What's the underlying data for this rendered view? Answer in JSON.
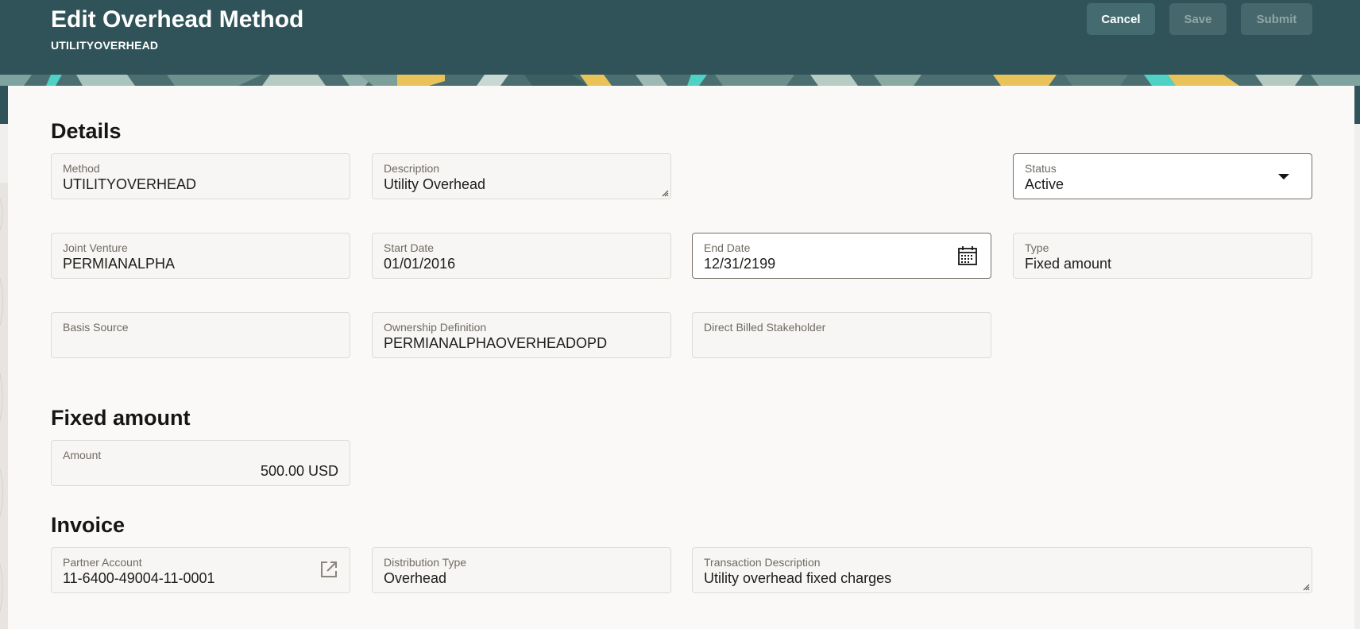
{
  "header": {
    "title": "Edit Overhead Method",
    "subtitle": "UTILITYOVERHEAD",
    "cancel_label": "Cancel",
    "save_label": "Save",
    "submit_label": "Submit"
  },
  "sections": {
    "details": "Details",
    "fixed_amount": "Fixed amount",
    "invoice": "Invoice"
  },
  "fields": {
    "method": {
      "label": "Method",
      "value": "UTILITYOVERHEAD"
    },
    "description": {
      "label": "Description",
      "value": "Utility Overhead"
    },
    "status": {
      "label": "Status",
      "value": "Active"
    },
    "joint_venture": {
      "label": "Joint Venture",
      "value": "PERMIANALPHA"
    },
    "start_date": {
      "label": "Start Date",
      "value": "01/01/2016"
    },
    "end_date": {
      "label": "End Date",
      "value": "12/31/2199"
    },
    "type": {
      "label": "Type",
      "value": "Fixed amount"
    },
    "basis_source": {
      "label": "Basis Source",
      "value": ""
    },
    "ownership_definition": {
      "label": "Ownership Definition",
      "value": "PERMIANALPHAOVERHEADOPD"
    },
    "direct_billed_stakeholder": {
      "label": "Direct Billed Stakeholder",
      "value": ""
    },
    "amount": {
      "label": "Amount",
      "value": "500.00 USD"
    },
    "partner_account": {
      "label": "Partner Account",
      "value": "11-6400-49004-11-0001"
    },
    "distribution_type": {
      "label": "Distribution Type",
      "value": "Overhead"
    },
    "transaction_description": {
      "label": "Transaction Description",
      "value": "Utility overhead fixed charges"
    }
  },
  "icons": {
    "status_dropdown": "chevron-down-icon",
    "end_date_picker": "calendar-icon",
    "partner_account_link": "external-link-icon",
    "textarea_resize": "resize-handle-icon"
  },
  "colors": {
    "header_bg": "#2f5358",
    "cancel_button_bg": "#446b70",
    "disabled_button_bg": "#46676b",
    "card_bg": "#fbf9f8",
    "banner_yellow": "#e9c35a",
    "banner_teal": "#4fd1c5"
  }
}
